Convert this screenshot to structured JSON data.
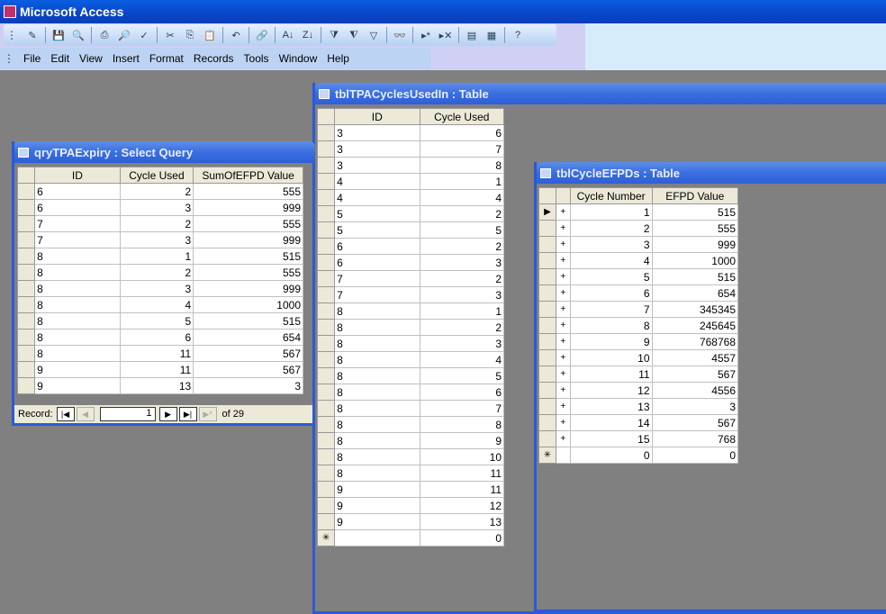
{
  "app_title": "Microsoft Access",
  "menu": [
    "File",
    "Edit",
    "View",
    "Insert",
    "Format",
    "Records",
    "Tools",
    "Window",
    "Help"
  ],
  "toolbar_icons": [
    "view-icon",
    "save-icon",
    "file-search-icon",
    "print-icon",
    "print-preview-icon",
    "spelling-icon",
    "cut-icon",
    "copy-icon",
    "paste-icon",
    "undo-icon",
    "hyperlink-icon",
    "sort-ascending-icon",
    "sort-descending-icon",
    "filter-by-selection-icon",
    "filter-by-form-icon",
    "apply-filter-icon",
    "find-icon",
    "new-record-icon",
    "delete-record-icon",
    "database-window-icon",
    "new-object-icon",
    "help-icon"
  ],
  "query": {
    "title": "qryTPAExpiry : Select Query",
    "columns": [
      "ID",
      "Cycle Used",
      "SumOfEFPD Value"
    ],
    "rows": [
      [
        "6",
        "2",
        "555"
      ],
      [
        "6",
        "3",
        "999"
      ],
      [
        "7",
        "2",
        "555"
      ],
      [
        "7",
        "3",
        "999"
      ],
      [
        "8",
        "1",
        "515"
      ],
      [
        "8",
        "2",
        "555"
      ],
      [
        "8",
        "3",
        "999"
      ],
      [
        "8",
        "4",
        "1000"
      ],
      [
        "8",
        "5",
        "515"
      ],
      [
        "8",
        "6",
        "654"
      ],
      [
        "8",
        "11",
        "567"
      ],
      [
        "9",
        "11",
        "567"
      ],
      [
        "9",
        "13",
        "3"
      ]
    ],
    "record_label": "Record:",
    "record_current": "1",
    "record_of": "of 29"
  },
  "cycles_used": {
    "title": "tblTPACyclesUsedIn : Table",
    "columns": [
      "ID",
      "Cycle Used"
    ],
    "rows": [
      [
        "3",
        "6"
      ],
      [
        "3",
        "7"
      ],
      [
        "3",
        "8"
      ],
      [
        "4",
        "1"
      ],
      [
        "4",
        "4"
      ],
      [
        "5",
        "2"
      ],
      [
        "5",
        "5"
      ],
      [
        "6",
        "2"
      ],
      [
        "6",
        "3"
      ],
      [
        "7",
        "2"
      ],
      [
        "7",
        "3"
      ],
      [
        "8",
        "1"
      ],
      [
        "8",
        "2"
      ],
      [
        "8",
        "3"
      ],
      [
        "8",
        "4"
      ],
      [
        "8",
        "5"
      ],
      [
        "8",
        "6"
      ],
      [
        "8",
        "7"
      ],
      [
        "8",
        "8"
      ],
      [
        "8",
        "9"
      ],
      [
        "8",
        "10"
      ],
      [
        "8",
        "11"
      ],
      [
        "9",
        "11"
      ],
      [
        "9",
        "12"
      ],
      [
        "9",
        "13"
      ]
    ],
    "new_row": [
      "",
      "0"
    ]
  },
  "efpds": {
    "title": "tblCycleEFPDs : Table",
    "columns": [
      "Cycle Number",
      "EFPD Value"
    ],
    "rows": [
      [
        "1",
        "515"
      ],
      [
        "2",
        "555"
      ],
      [
        "3",
        "999"
      ],
      [
        "4",
        "1000"
      ],
      [
        "5",
        "515"
      ],
      [
        "6",
        "654"
      ],
      [
        "7",
        "345345"
      ],
      [
        "8",
        "245645"
      ],
      [
        "9",
        "768768"
      ],
      [
        "10",
        "4557"
      ],
      [
        "11",
        "567"
      ],
      [
        "12",
        "4556"
      ],
      [
        "13",
        "3"
      ],
      [
        "14",
        "567"
      ],
      [
        "15",
        "768"
      ]
    ],
    "new_row": [
      "0",
      "0"
    ]
  }
}
